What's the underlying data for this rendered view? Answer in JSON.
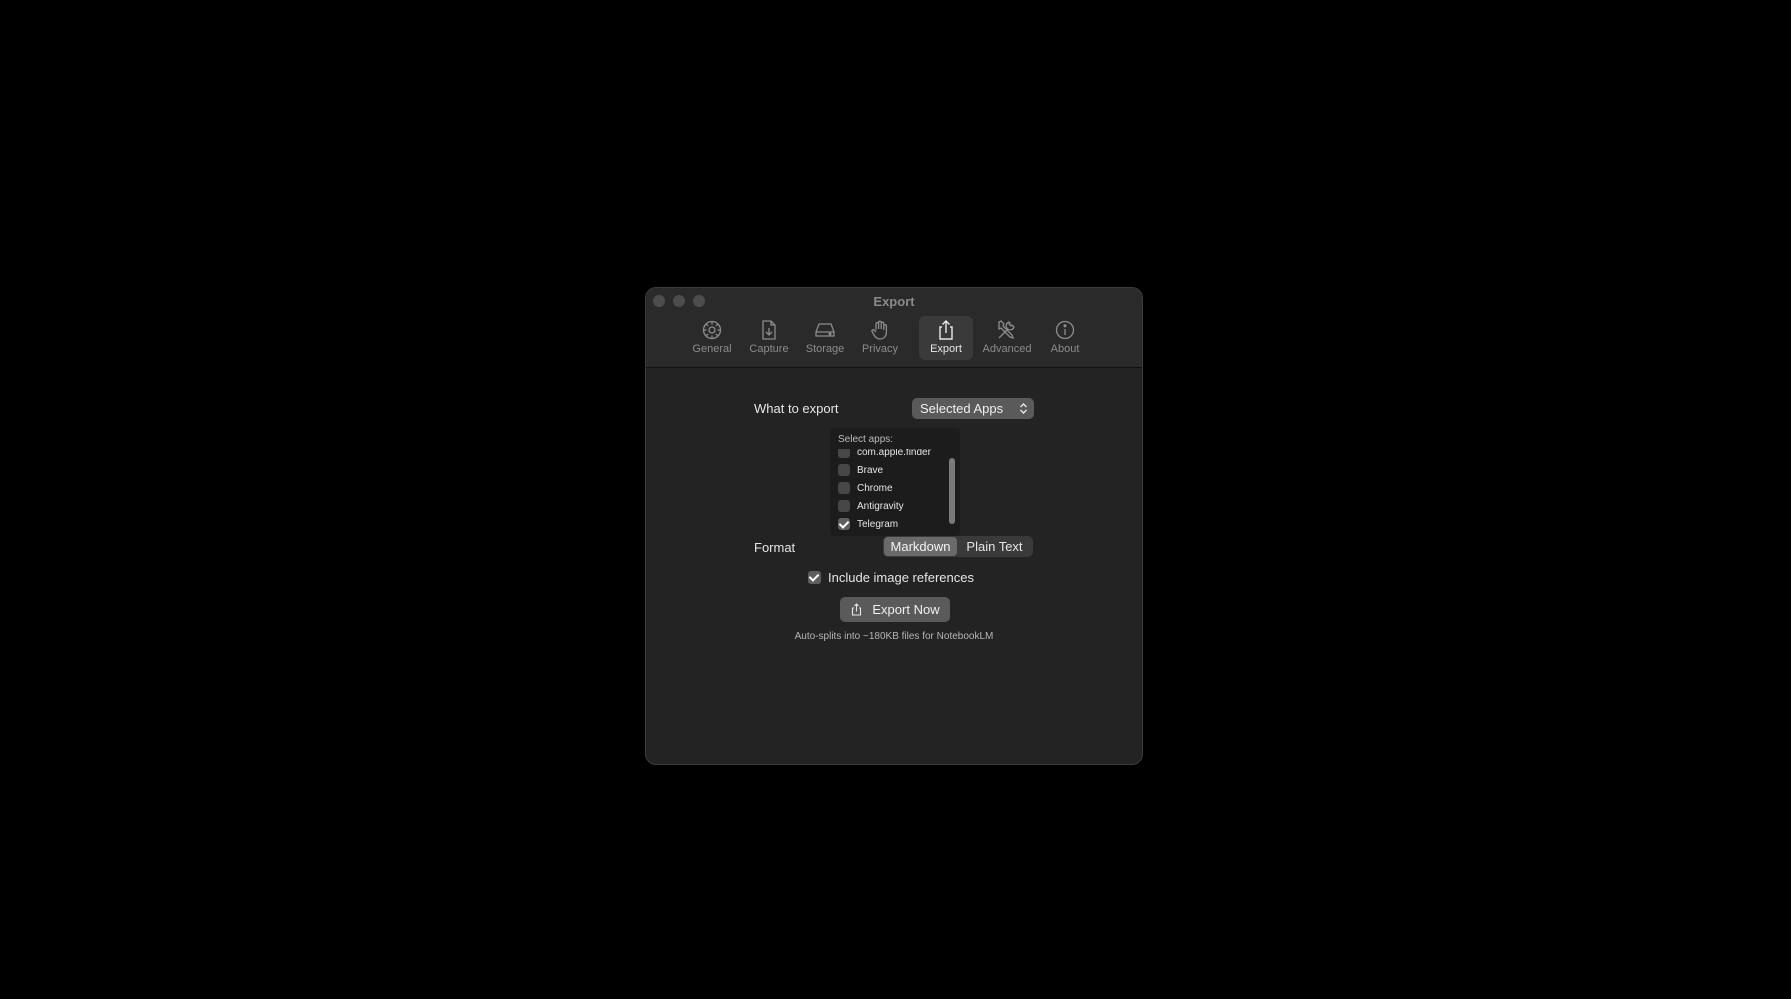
{
  "window": {
    "title": "Export"
  },
  "toolbar": {
    "tabs": [
      {
        "label": "General",
        "icon": "gear-icon"
      },
      {
        "label": "Capture",
        "icon": "document-download-icon"
      },
      {
        "label": "Storage",
        "icon": "drive-icon"
      },
      {
        "label": "Privacy",
        "icon": "hand-icon"
      },
      {
        "label": "Export",
        "icon": "share-icon",
        "active": true
      },
      {
        "label": "Advanced",
        "icon": "tools-icon"
      },
      {
        "label": "About",
        "icon": "info-icon"
      }
    ]
  },
  "export": {
    "what_label": "What to export",
    "what_value": "Selected Apps",
    "select_apps_label": "Select apps:",
    "apps": [
      {
        "name": "com.apple.finder",
        "checked": false
      },
      {
        "name": "Brave",
        "checked": false
      },
      {
        "name": "Chrome",
        "checked": false
      },
      {
        "name": "Antigravity",
        "checked": false
      },
      {
        "name": "Telegram",
        "checked": true
      }
    ],
    "format_label": "Format",
    "format_options": [
      "Markdown",
      "Plain Text"
    ],
    "format_selected": "Markdown",
    "include_images_label": "Include image references",
    "include_images_checked": true,
    "export_button": "Export Now",
    "note": "Auto-splits into ~180KB files for NotebookLM"
  },
  "colors": {
    "background": "#000000",
    "window": "#232323",
    "toolbar": "#2a2a2a",
    "active_tab": "#3a3a3a"
  }
}
